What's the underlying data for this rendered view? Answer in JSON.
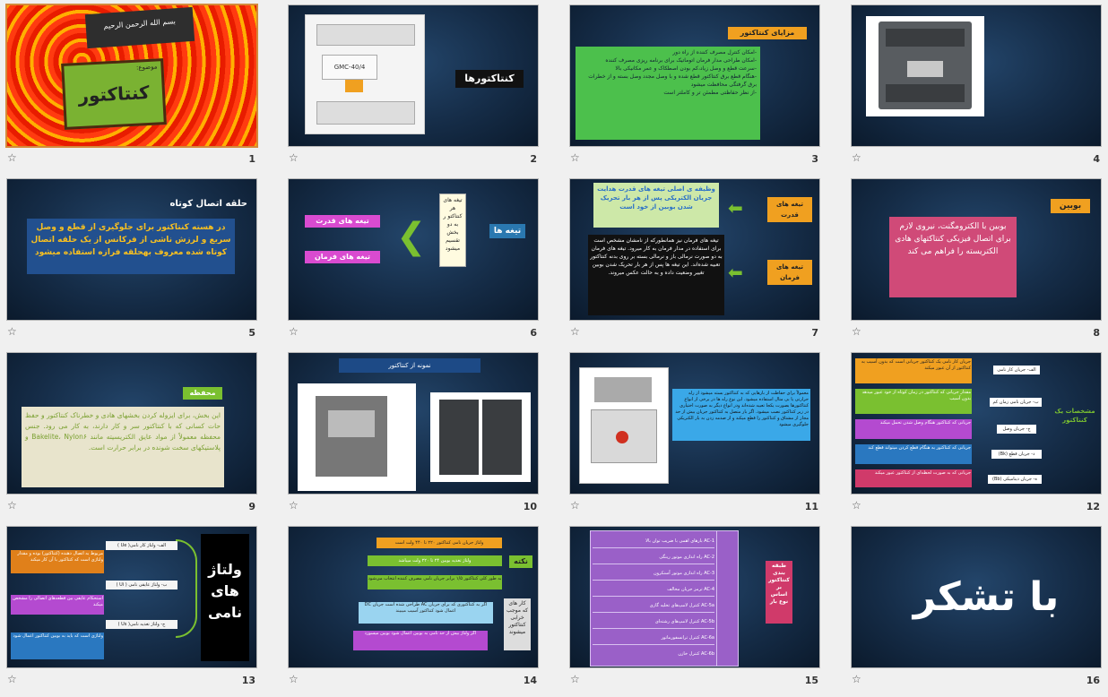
{
  "slides": [
    {
      "number": "1",
      "bismillah": "بسم الله الرحمن الرحيم",
      "subject_label": "موضوع:",
      "title": "کنتاکتور"
    },
    {
      "number": "2",
      "title": "کنتاکتورها",
      "device_text": "GMC-40/4"
    },
    {
      "number": "3",
      "heading": "مزایای کنتاکتور",
      "items": [
        "-امکان کنترل مصرف کننده از راه دور",
        "-امکان طراحی مدار فرمان اتوماتیک برای برنامه ریزی مصرف کننده",
        "-سرعت قطع و وصل زیاد،کم بودن اصطکاک و عمر مکانیکی بالا",
        "-هنگام قطع برق کنتاکتور قطع شده و با وصل مجدد وصل بسته و از خطرات برق گرفتگی محافظت میشود",
        "-از نظر حفاظتی مطمئن تر و کاملتر است"
      ]
    },
    {
      "number": "4"
    },
    {
      "number": "5",
      "heading": "حلقه اتصال کوتاه",
      "body": "در هسته کنتاکتور برای جلوگیری از قطع و وصل سریع و لرزش ناشی از فرکانس از یک حلقه اتصال کوتاه شده معروف بهحلقه فرازه استفاده میشود"
    },
    {
      "number": "6",
      "center_label": "تیغه ها",
      "mid_text": "تیغه های هر کنتاکتو ر به دو بخش تقسیم میشود",
      "power_label": "تیغه های قدرت",
      "control_label": "تیغه های فرمان"
    },
    {
      "number": "7",
      "power_label": "تیغه های قدرت",
      "control_label": "تیغه های فرمان",
      "power_desc": "وظیفه ی اصلی تیغه های قدرت هدایت جریان الکتریکی پس از هر بار تحریک شدن بوبین از خود است",
      "control_desc": "تیغه های فرمان نیز همانطورکه از نامشان مشخص است برای استفاده در مدار فرمان به کار میرود. تیغه های فرمان به دو صورت نرمالی باز و نرمالی بسته بر روی بدنه کنتاکتور تعبیه شده‌اند. این تیغه ها پس از هر بار تحریک شدن بوبین تغییر وضعیت داده و به حالت عکس میروند."
    },
    {
      "number": "8",
      "heading": "بوبین",
      "body": "بوبین با الکترومگنت، نیروی لازم برای اتصال فیزیکی کنتاکتهای هادی الکتریسته را فراهم می کند"
    },
    {
      "number": "9",
      "heading": "محفظه",
      "body": "این بخش، برای ایزوله کردن بخشهای هادی و خطرناک کنتاکتور و حفظ حات کسانی که با کنتاکتور سر و کار دارند، به کار می رود. جنس محفظه معمولاً از مواد عایق الکتریسیته مانند Bakelite، Nylon۶ و پلاستیکهای سخت شونده در برابر حرارت است."
    },
    {
      "number": "10",
      "heading": "نمونه از کنتاکتور"
    },
    {
      "number": "11",
      "body": "معمولاً برای حفاظت از بارهایی که به کنتاکتور بسته میشود از رله حرارتی یا بی متال استفاده میشود. این نوع رله ها در برخی از انواع کنتاکتورها بصورت یکجا تعبیه شده‌اند ودر انواع دیگر به صورت اختیاری در زیر کنتاکتور نصب میشود. اگر بار متصل به کنتاکتور جریان بیش از حد مجاز از مشتاق و کنتاکتور را قطع میکند و از صدمه زدن به بار الکتریکی جلوگیری میشود"
    },
    {
      "number": "12",
      "side_label": "مشخصات یک کنتاکتور",
      "items": [
        {
          "label": "الف- جریان کار نامی",
          "desc": "جریان کار نامی یک کنتاکتور جریانی است که بدون آسیب به کنتاکتور از آن عبور میکند"
        },
        {
          "label": "ب- جریان نامی زمان کم",
          "desc": "مقدار جریانی که کنتاکتور در زمان کوتاه از خود عبور میدهد بدون آسیب"
        },
        {
          "label": "ج- جریان وصل",
          "desc": "جریانی که کنتاکتور هنگام وصل شدن تحمل میکند"
        },
        {
          "label": "د- جریان قطع (Bk)",
          "desc": "جریانی که کنتاکتور به هنگام قطع کردن میتواند قطع کند"
        },
        {
          "label": "ه- جریان دینامیکی (Bb)",
          "desc": "جریانی که به صورت لحظه‌ای از کنتاکتور عبور میکند"
        }
      ]
    },
    {
      "number": "13",
      "title": "ولتاژ های نامی",
      "items": [
        {
          "label": "الف- ولتاژ کار نامی( Ue )",
          "desc": "مربوط به اتصال دهنده (کنتاکتور) بوده و مقدار ولتاژی است که کنتاکتور با آن کار میکند"
        },
        {
          "label": "ب- ولتاژ عایقی نامی ( Ui )",
          "desc": "استحکام عایقی بین قطعه‌های اتصالی را مشخص میکند"
        },
        {
          "label": "ج- ولتاژ تغذیه نامی( Us )",
          "desc": "ولتاژی است که باید به بوبین کنتاکتور اعمال شود"
        }
      ]
    },
    {
      "number": "14",
      "heading": "نکته",
      "side_text": "کار های که موجب خرابی کنتاکتور میشوند",
      "items": [
        "ولتاژ جریان نامی کنتاکتور ۲۲۰ تا ۴۴۰ ولت است",
        "ولتاژ تغذیه بوبین ۲۴ تا ۲۲۰ ولت میباشد",
        "به طور کلی کنتاکتور ۱/۵ برابر جریان نامی مصرف کننده انتخاب می‌شود",
        "اگر به کنتاکتوری که برای جریان AC طراحی شده است جریان DC اعمال شود کنتاکتور آسیب میبیند",
        "اگر ولتاژ بیش از حد نامی به بوبین اعمال شود بوبین میسوزد"
      ]
    },
    {
      "number": "15",
      "side_text": "طبقه بندی کنتاکتور بر اساس نوع بار",
      "rows": [
        "AC-1 بارهای اهمی با ضریب توان بالا",
        "AC-2 راه اندازی موتور رینگی",
        "AC-3 راه اندازی موتور آسنکرون",
        "AC-4 ترمز جریان مخالف",
        "AC-5a کنترل لامپ‌های تخلیه گازی",
        "AC-5b کنترل لامپ‌های رشته‌ای",
        "AC-6a کنترل ترانسفورماتور",
        "AC-6b کنترل خازن"
      ]
    },
    {
      "number": "16",
      "title": "با تشکر"
    }
  ],
  "colors": {
    "selection": "#d48a3a",
    "slide_bg": "#152c47"
  }
}
